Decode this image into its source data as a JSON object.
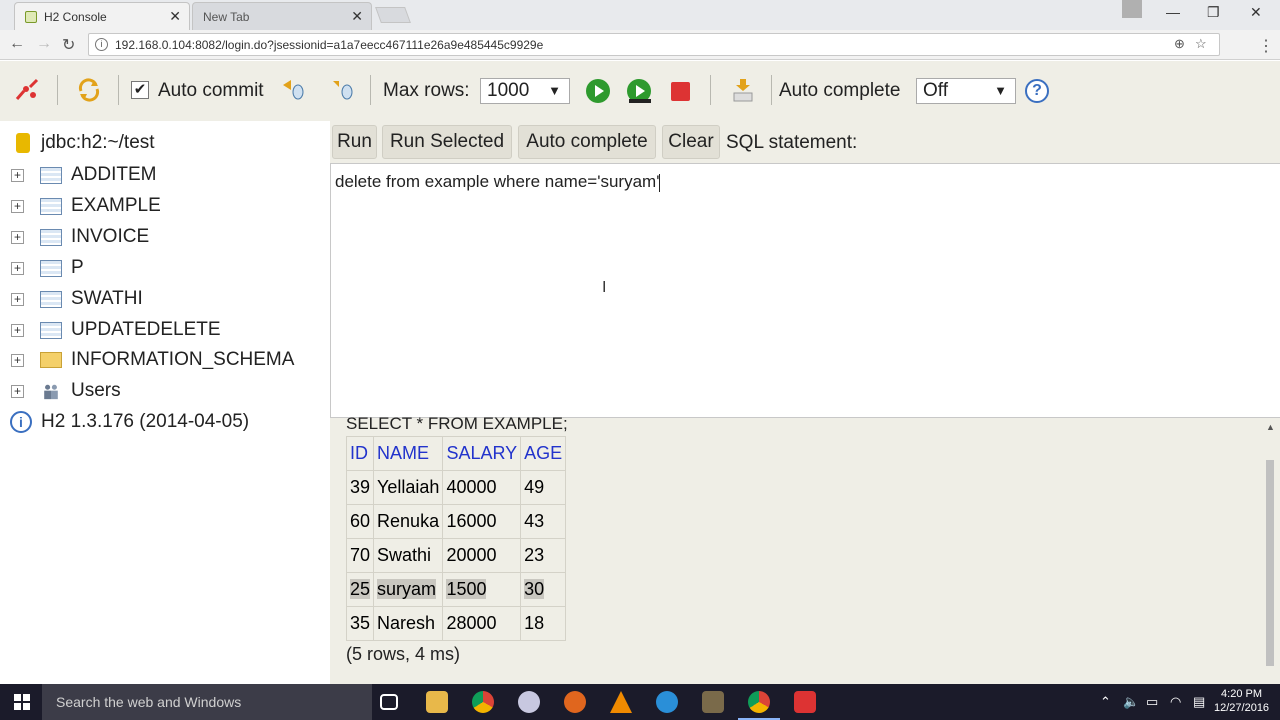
{
  "browser": {
    "tab_active": "H2 Console",
    "tab_inactive": "New Tab",
    "url": "192.168.0.104:8082/login.do?jsessionid=a1a7eecc467111e26a9e485445c9929e"
  },
  "toolbar": {
    "auto_commit_label": "Auto commit",
    "auto_commit_checked": true,
    "max_rows_label": "Max rows:",
    "max_rows_value": "1000",
    "auto_complete_label": "Auto complete",
    "auto_complete_value": "Off",
    "help_glyph": "?"
  },
  "tree": {
    "connection": "jdbc:h2:~/test",
    "items": [
      {
        "label": "ADDITEM",
        "icon": "table-icon"
      },
      {
        "label": "EXAMPLE",
        "icon": "table-icon"
      },
      {
        "label": "INVOICE",
        "icon": "table-icon"
      },
      {
        "label": "P",
        "icon": "table-icon"
      },
      {
        "label": "SWATHI",
        "icon": "table-icon"
      },
      {
        "label": "UPDATEDELETE",
        "icon": "table-icon"
      },
      {
        "label": "INFORMATION_SCHEMA",
        "icon": "folder-icon"
      },
      {
        "label": "Users",
        "icon": "users-icon"
      }
    ],
    "version": "H2 1.3.176 (2014-04-05)"
  },
  "editor": {
    "buttons": {
      "run": "Run",
      "run_selected": "Run Selected",
      "auto_complete": "Auto complete",
      "clear": "Clear"
    },
    "sql_label": "SQL statement:",
    "sql_text": "delete from example where name='suryam'"
  },
  "results": {
    "query": "SELECT * FROM EXAMPLE;",
    "columns": [
      "ID",
      "NAME",
      "SALARY",
      "AGE"
    ],
    "rows": [
      [
        "39",
        "Yellaiah",
        "40000",
        "49"
      ],
      [
        "60",
        "Renuka",
        "16000",
        "43"
      ],
      [
        "70",
        "Swathi",
        "20000",
        "23"
      ],
      [
        "25",
        "suryam",
        "1500",
        "30"
      ],
      [
        "35",
        "Naresh",
        "28000",
        "18"
      ]
    ],
    "highlighted_row": 3,
    "row_count": "(5 rows, 4 ms)"
  },
  "taskbar": {
    "search_placeholder": "Search the web and Windows",
    "time": "4:20 PM",
    "date": "12/27/2016"
  }
}
